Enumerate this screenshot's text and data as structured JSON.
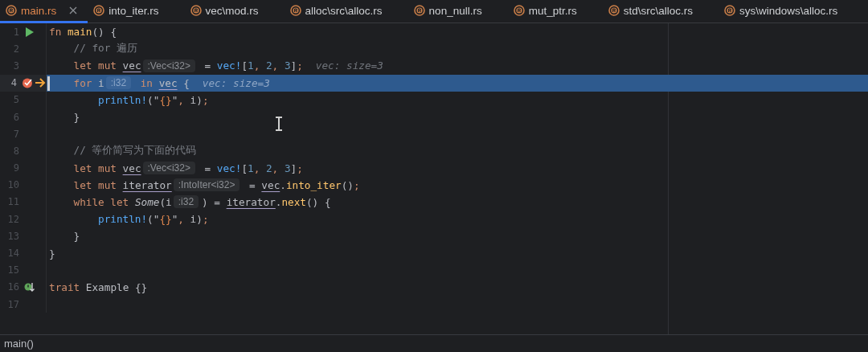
{
  "tabs": [
    {
      "label": "main.rs",
      "selected": true
    },
    {
      "label": "into_iter.rs",
      "selected": false
    },
    {
      "label": "vec\\mod.rs",
      "selected": false
    },
    {
      "label": "alloc\\src\\alloc.rs",
      "selected": false
    },
    {
      "label": "non_null.rs",
      "selected": false
    },
    {
      "label": "mut_ptr.rs",
      "selected": false
    },
    {
      "label": "std\\src\\alloc.rs",
      "selected": false
    },
    {
      "label": "sys\\windows\\alloc.rs",
      "selected": false
    }
  ],
  "lines": [
    {
      "number": "1",
      "current": false,
      "run_marker": true,
      "segments": [
        {
          "kind": "code",
          "tokens": [
            {
              "kind": "keyword",
              "text": "fn "
            },
            {
              "kind": "method",
              "text": "main"
            },
            {
              "kind": "plain",
              "text": "() {"
            }
          ]
        }
      ],
      "children": [
        {
          "number": "2",
          "current": false,
          "segments": [
            {
              "kind": "code",
              "tokens": [
                {
                  "kind": "comment",
                  "text": "// for 遍历"
                }
              ]
            }
          ]
        },
        {
          "number": "3",
          "current": false,
          "segments": [
            {
              "kind": "code",
              "tokens": [
                {
                  "kind": "keyword",
                  "text": "let mut "
                },
                {
                  "kind": "mutable",
                  "text": "vec"
                }
              ]
            },
            {
              "kind": "hint",
              "text": ":Vec<i32>"
            },
            {
              "kind": "code",
              "tokens": [
                {
                  "kind": "plain",
                  "text": " = "
                },
                {
                  "kind": "macro",
                  "text": "vec!"
                },
                {
                  "kind": "plain",
                  "text": "["
                },
                {
                  "kind": "number",
                  "text": "1"
                },
                {
                  "kind": "keyword",
                  "text": ", "
                },
                {
                  "kind": "number",
                  "text": "2"
                },
                {
                  "kind": "keyword",
                  "text": ", "
                },
                {
                  "kind": "number",
                  "text": "3"
                },
                {
                  "kind": "plain",
                  "text": "]"
                },
                {
                  "kind": "keyword",
                  "text": ";"
                }
              ]
            },
            {
              "kind": "value",
              "text": "vec: size=3"
            }
          ]
        },
        {
          "number": "4",
          "current": true,
          "breakpoint": true,
          "execution_point": true,
          "segments": [
            {
              "kind": "code",
              "tokens": [
                {
                  "kind": "keyword",
                  "text": "for "
                },
                {
                  "kind": "plain",
                  "text": "i"
                }
              ]
            },
            {
              "kind": "hint",
              "text": ":i32"
            },
            {
              "kind": "code",
              "tokens": [
                {
                  "kind": "keyword",
                  "text": " in "
                },
                {
                  "kind": "mutable",
                  "text": "vec"
                },
                {
                  "kind": "plain",
                  "text": " {"
                }
              ]
            },
            {
              "kind": "value",
              "text": "vec: size=3"
            }
          ],
          "children": [
            {
              "number": "5",
              "current": false,
              "segments": [
                {
                  "kind": "code",
                  "tokens": [
                    {
                      "kind": "macro",
                      "text": "println!"
                    },
                    {
                      "kind": "plain",
                      "text": "(\""
                    },
                    {
                      "kind": "format",
                      "text": "{}"
                    },
                    {
                      "kind": "plain",
                      "text": "\""
                    },
                    {
                      "kind": "keyword",
                      "text": ", "
                    },
                    {
                      "kind": "plain",
                      "text": "i)"
                    },
                    {
                      "kind": "keyword",
                      "text": ";"
                    }
                  ]
                }
              ]
            }
          ]
        },
        {
          "number": "6",
          "current": false,
          "segments": [
            {
              "kind": "code",
              "tokens": [
                {
                  "kind": "plain",
                  "text": "}"
                }
              ]
            }
          ]
        },
        {
          "number": "7",
          "current": false
        },
        {
          "number": "8",
          "current": false,
          "segments": [
            {
              "kind": "code",
              "tokens": [
                {
                  "kind": "comment",
                  "text": "// 等价简写为下面的代码"
                }
              ]
            }
          ]
        },
        {
          "number": "9",
          "current": false,
          "segments": [
            {
              "kind": "code",
              "tokens": [
                {
                  "kind": "keyword",
                  "text": "let mut "
                },
                {
                  "kind": "mutable",
                  "text": "vec"
                }
              ]
            },
            {
              "kind": "hint",
              "text": ":Vec<i32>"
            },
            {
              "kind": "code",
              "tokens": [
                {
                  "kind": "plain",
                  "text": " = "
                },
                {
                  "kind": "macro",
                  "text": "vec!"
                },
                {
                  "kind": "plain",
                  "text": "["
                },
                {
                  "kind": "number",
                  "text": "1"
                },
                {
                  "kind": "keyword",
                  "text": ", "
                },
                {
                  "kind": "number",
                  "text": "2"
                },
                {
                  "kind": "keyword",
                  "text": ", "
                },
                {
                  "kind": "number",
                  "text": "3"
                },
                {
                  "kind": "plain",
                  "text": "]"
                },
                {
                  "kind": "keyword",
                  "text": ";"
                }
              ]
            }
          ]
        },
        {
          "number": "10",
          "current": false,
          "segments": [
            {
              "kind": "code",
              "tokens": [
                {
                  "kind": "keyword",
                  "text": "let mut "
                },
                {
                  "kind": "mutable",
                  "text": "iterator"
                }
              ]
            },
            {
              "kind": "hint",
              "text": ":IntoIter<i32>"
            },
            {
              "kind": "code",
              "tokens": [
                {
                  "kind": "plain",
                  "text": " = "
                },
                {
                  "kind": "mutable",
                  "text": "vec"
                },
                {
                  "kind": "plain",
                  "text": "."
                },
                {
                  "kind": "method",
                  "text": "into_iter"
                },
                {
                  "kind": "plain",
                  "text": "()"
                },
                {
                  "kind": "keyword",
                  "text": ";"
                }
              ]
            }
          ]
        },
        {
          "number": "11",
          "current": false,
          "segments": [
            {
              "kind": "code",
              "tokens": [
                {
                  "kind": "keyword",
                  "text": "while let "
                },
                {
                  "kind": "variant",
                  "text": "Some"
                },
                {
                  "kind": "plain",
                  "text": "(i"
                }
              ]
            },
            {
              "kind": "hint",
              "text": ":i32"
            },
            {
              "kind": "code",
              "tokens": [
                {
                  "kind": "plain",
                  "text": ") = "
                },
                {
                  "kind": "mutable",
                  "text": "iterator"
                },
                {
                  "kind": "plain",
                  "text": "."
                },
                {
                  "kind": "method",
                  "text": "next"
                },
                {
                  "kind": "plain",
                  "text": "() {"
                }
              ]
            }
          ],
          "children": [
            {
              "number": "12",
              "current": false,
              "segments": [
                {
                  "kind": "code",
                  "tokens": [
                    {
                      "kind": "macro",
                      "text": "println!"
                    },
                    {
                      "kind": "plain",
                      "text": "(\""
                    },
                    {
                      "kind": "format",
                      "text": "{}"
                    },
                    {
                      "kind": "plain",
                      "text": "\""
                    },
                    {
                      "kind": "keyword",
                      "text": ", "
                    },
                    {
                      "kind": "plain",
                      "text": "i)"
                    },
                    {
                      "kind": "keyword",
                      "text": ";"
                    }
                  ]
                }
              ]
            }
          ]
        },
        {
          "number": "13",
          "current": false,
          "segments": [
            {
              "kind": "code",
              "tokens": [
                {
                  "kind": "plain",
                  "text": "}"
                }
              ]
            }
          ]
        }
      ]
    },
    {
      "number": "14",
      "current": false,
      "segments": [
        {
          "kind": "code",
          "tokens": [
            {
              "kind": "plain",
              "text": "}"
            }
          ]
        }
      ]
    },
    {
      "number": "15",
      "current": false
    },
    {
      "number": "16",
      "current": false,
      "implemented_marker": true,
      "segments": [
        {
          "kind": "code",
          "tokens": [
            {
              "kind": "keyword",
              "text": "trait "
            },
            {
              "kind": "plain",
              "text": "Example {}"
            }
          ]
        }
      ]
    },
    {
      "number": "17",
      "current": false
    }
  ],
  "status_bar": {
    "breadcrumb": "main()"
  }
}
